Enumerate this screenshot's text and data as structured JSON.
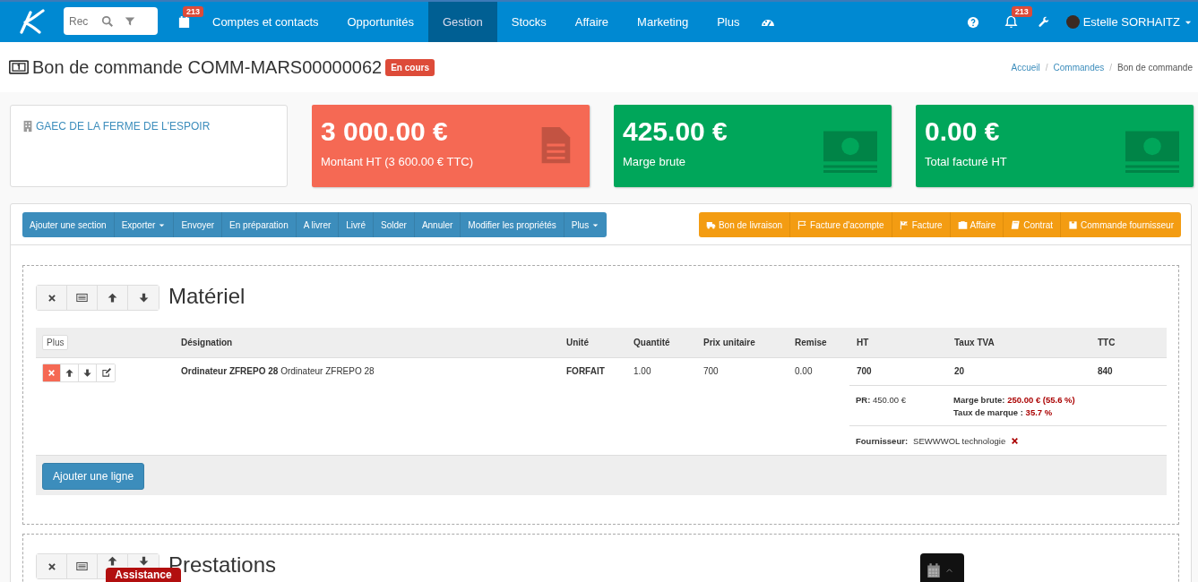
{
  "navbar": {
    "search": {
      "placeholder": "Rec"
    },
    "calendar_badge": "213",
    "items": [
      {
        "label": "Comptes et contacts",
        "selected": false
      },
      {
        "label": "Opportunités",
        "selected": false
      },
      {
        "label": "Gestion",
        "selected": true
      },
      {
        "label": "Stocks",
        "selected": false
      },
      {
        "label": "Affaire",
        "selected": false
      },
      {
        "label": "Marketing",
        "selected": false
      },
      {
        "label": "Plus",
        "selected": false
      }
    ],
    "notification_badge": "213",
    "user": "Estelle SORHAITZ"
  },
  "page": {
    "title": "Bon de commande COMM-MARS00000062",
    "status": "En cours",
    "breadcrumb_separator": "/",
    "breadcrumb": [
      {
        "label": "Accueil",
        "link": true
      },
      {
        "label": "Commandes",
        "link": true
      },
      {
        "label": "Bon de commande",
        "link": false
      }
    ]
  },
  "customer": {
    "name": "GAEC DE LA FERME DE L'ESPOIR"
  },
  "stats": [
    {
      "value": "3 000.00 €",
      "label": "Montant HT (3 600.00 € TTC)",
      "color": "#f56954",
      "kind": "document"
    },
    {
      "value": "425.00 €",
      "label": "Marge brute",
      "color": "#00a65a",
      "kind": "cash"
    },
    {
      "value": "0.00 €",
      "label": "Total facturé HT",
      "color": "#00a65a",
      "kind": "cash"
    }
  ],
  "actions": [
    {
      "label": "Ajouter une section",
      "dropdown": false
    },
    {
      "label": "Exporter",
      "dropdown": true
    },
    {
      "label": "Envoyer",
      "dropdown": false
    },
    {
      "label": "En préparation",
      "dropdown": false
    },
    {
      "label": "A livrer",
      "dropdown": false
    },
    {
      "label": "Livré",
      "dropdown": false
    },
    {
      "label": "Solder",
      "dropdown": false
    },
    {
      "label": "Annuler",
      "dropdown": false
    },
    {
      "label": "Modifier les propriétés",
      "dropdown": false
    },
    {
      "label": "Plus",
      "dropdown": true
    }
  ],
  "create_actions": [
    {
      "label": "Bon de livraison",
      "kind": "truck"
    },
    {
      "label": "Facture d'acompte",
      "kind": "flag"
    },
    {
      "label": "Facture",
      "kind": "flag-checkered"
    },
    {
      "label": "Affaire",
      "kind": "briefcase"
    },
    {
      "label": "Contrat",
      "kind": "book"
    },
    {
      "label": "Commande fournisseur",
      "kind": "square"
    }
  ],
  "sections": [
    {
      "title": "Matériel",
      "table": {
        "more_button": "Plus",
        "columns": [
          "Désignation",
          "Unité",
          "Quantité",
          "Prix unitaire",
          "Remise",
          "HT",
          "Taux TVA",
          "TTC"
        ],
        "rows": [
          {
            "cells": [
              "**Ordinateur ZFREPO 28** Ordinateur ZFREPO 28",
              "FORFAIT",
              "1.00",
              "700",
              "0.00",
              "700",
              "20",
              "840"
            ],
            "pr_label": "PR:",
            "pr_value": "450.00 €",
            "margin_label": "Marge brute:",
            "margin_value": "250.00 € (55.6 %)",
            "markup_label": "Taux de marque :",
            "markup_value": "35.7 %",
            "supplier_label": "Fournisseur:",
            "supplier_value": "SEWWWOL technologie"
          }
        ],
        "add_button": "Ajouter une ligne"
      }
    },
    {
      "title": "Prestations"
    }
  ],
  "assistance": "Assistance"
}
